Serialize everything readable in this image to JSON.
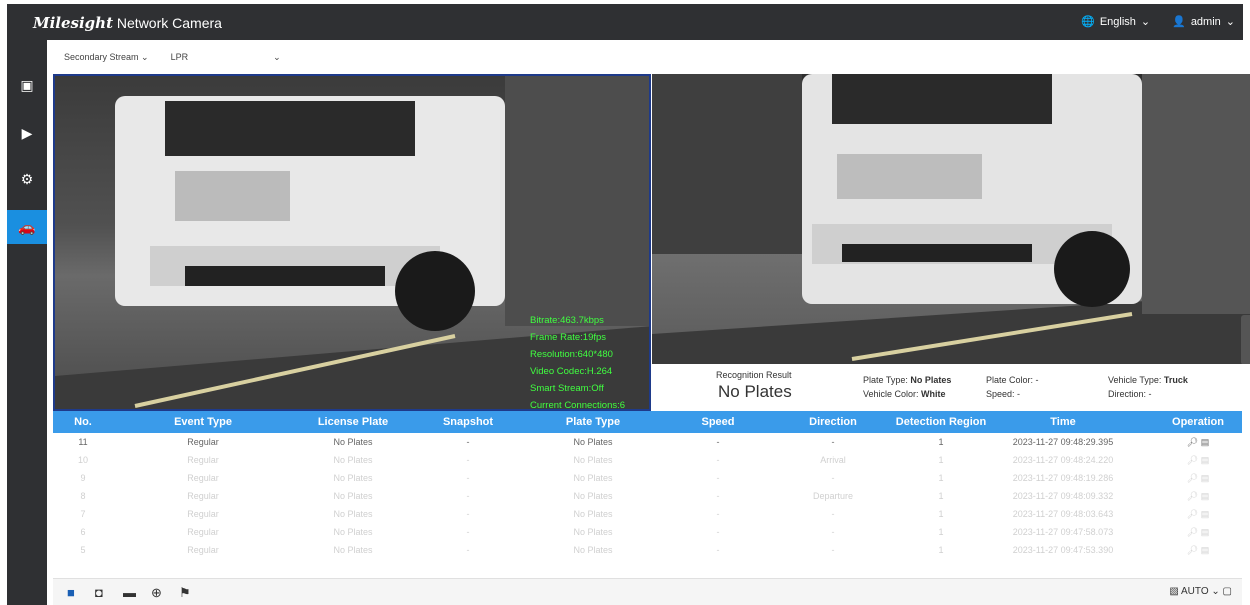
{
  "header": {
    "logo": "Milesight",
    "title": "Network Camera",
    "language": "English",
    "user": "admin"
  },
  "sidebar": {
    "items": [
      "live-view",
      "playback",
      "settings",
      "lpr"
    ]
  },
  "stream": {
    "stream_select": "Secondary Stream",
    "mode_select": "LPR"
  },
  "osd": {
    "bitrate": "Bitrate:463.7kbps",
    "frame_rate": "Frame Rate:19fps",
    "resolution": "Resolution:640*480",
    "codec": "Video Codec:H.264",
    "smart_stream": "Smart Stream:Off",
    "connections": "Current Connections:6"
  },
  "recognition": {
    "label": "Recognition Result",
    "value": "No Plates",
    "plate_type_label": "Plate Type:",
    "plate_type": "No Plates",
    "vehicle_color_label": "Vehicle Color:",
    "vehicle_color": "White",
    "plate_color_label": "Plate Color:",
    "plate_color": "-",
    "speed_label": "Speed:",
    "speed": "-",
    "vehicle_type_label": "Vehicle Type:",
    "vehicle_type": "Truck",
    "direction_label": "Direction:",
    "direction": "-"
  },
  "table": {
    "headers": [
      "No.",
      "Event Type",
      "License Plate",
      "Snapshot",
      "Plate Type",
      "Speed",
      "Direction",
      "Detection Region",
      "Time",
      "Operation"
    ],
    "rows": [
      [
        "11",
        "Regular",
        "No Plates",
        "-",
        "No Plates",
        "-",
        "-",
        "1",
        "2023-11-27 09:48:29.395"
      ],
      [
        "10",
        "Regular",
        "No Plates",
        "-",
        "No Plates",
        "-",
        "Arrival",
        "1",
        "2023-11-27 09:48:24.220"
      ],
      [
        "9",
        "Regular",
        "No Plates",
        "-",
        "No Plates",
        "-",
        "-",
        "1",
        "2023-11-27 09:48:19.286"
      ],
      [
        "8",
        "Regular",
        "No Plates",
        "-",
        "No Plates",
        "-",
        "Departure",
        "1",
        "2023-11-27 09:48:09.332"
      ],
      [
        "7",
        "Regular",
        "No Plates",
        "-",
        "No Plates",
        "-",
        "-",
        "1",
        "2023-11-27 09:48:03.643"
      ],
      [
        "6",
        "Regular",
        "No Plates",
        "-",
        "No Plates",
        "-",
        "-",
        "1",
        "2023-11-27 09:47:58.073"
      ],
      [
        "5",
        "Regular",
        "No Plates",
        "-",
        "No Plates",
        "-",
        "-",
        "1",
        "2023-11-27 09:47:53.390"
      ]
    ]
  },
  "bottombar": {
    "zoom": "AUTO"
  }
}
